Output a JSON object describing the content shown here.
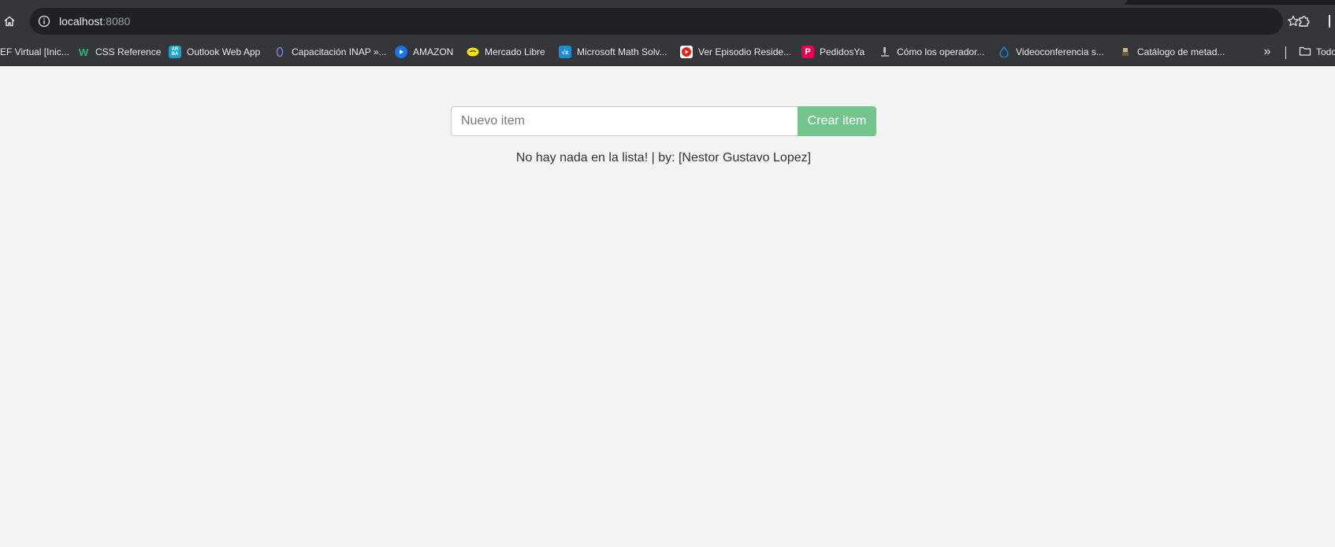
{
  "browser": {
    "url_host": "localhost",
    "url_port": ":8080",
    "bookmarks": [
      {
        "label": "EF Virtual [Inic...",
        "icon": "bookmark-generic-icon"
      },
      {
        "label": "CSS Reference",
        "icon": "css-reference-icon",
        "color": "#2bb673"
      },
      {
        "label": "Outlook Web App",
        "icon": "outlook-icon",
        "badge": "AR BA",
        "color": "#1aa3c8"
      },
      {
        "label": "Capacitación INAP »...",
        "icon": "inap-icon",
        "color": "#5b6ee1"
      },
      {
        "label": "AMAZON",
        "icon": "amazon-play-icon",
        "color": "#1a73e8"
      },
      {
        "label": "Mercado Libre",
        "icon": "mercado-libre-icon",
        "color": "#ffe600"
      },
      {
        "label": "Microsoft Math Solv...",
        "icon": "math-solver-icon",
        "color": "#1a8dd6"
      },
      {
        "label": "Ver Episodio Reside...",
        "icon": "youtube-icon",
        "color": "#e62117"
      },
      {
        "label": "PedidosYa",
        "icon": "pedidosya-icon",
        "badge": "P",
        "color": "#ea0050"
      },
      {
        "label": "Cómo los operador...",
        "icon": "microscope-icon"
      },
      {
        "label": "Videoconferencia s...",
        "icon": "drupal-icon",
        "color": "#1e88e5"
      },
      {
        "label": "Catálogo de metad...",
        "icon": "catalog-icon"
      }
    ],
    "more_label": "»",
    "folder_label": "Todo"
  },
  "app": {
    "input_placeholder": "Nuevo item",
    "input_value": "",
    "create_button_label": "Crear item",
    "empty_message": "No hay nada en la lista! | by: [Nestor Gustavo Lopez]"
  },
  "colors": {
    "accent_green": "#74c48e",
    "page_background": "#f3f3f3",
    "chrome_dark": "#35363a"
  }
}
